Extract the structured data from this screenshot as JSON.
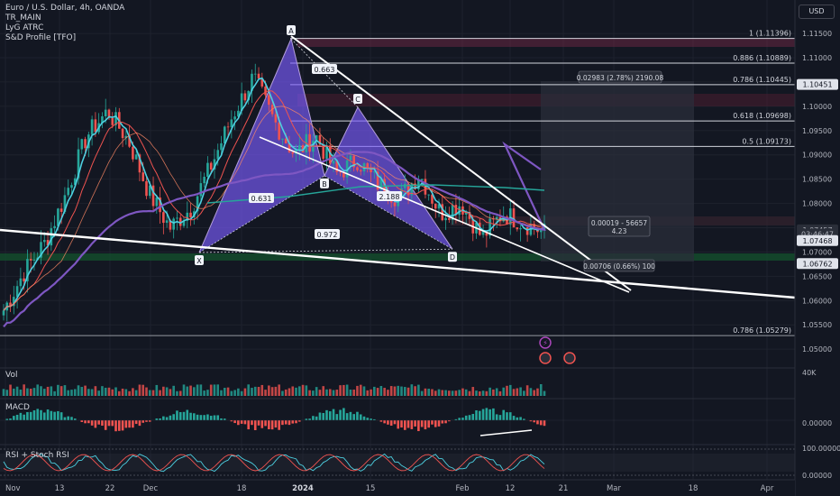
{
  "header": {
    "title": "Euro / U.S. Dollar, 4h, OANDA",
    "indicators": [
      "TR_MAIN",
      "LyG ATRC",
      "S&D Profile [TFO]"
    ]
  },
  "currency_button": "USD",
  "price_axis": {
    "ticks": [
      "1.11500",
      "1.11000",
      "1.10500",
      "1.10000",
      "1.09500",
      "1.09000",
      "1.08500",
      "1.08000",
      "1.07500",
      "1.07000",
      "1.06500",
      "1.06000",
      "1.05500",
      "1.05000"
    ],
    "badges": [
      {
        "text": "1.10451",
        "value": 1.10451,
        "style": "light"
      },
      {
        "text": "1.07457",
        "value": 1.07457,
        "style": "dark"
      },
      {
        "text": "03:46:47",
        "value": 1.0737,
        "style": "dark"
      },
      {
        "text": "1.07468",
        "value": 1.07235,
        "style": "light"
      },
      {
        "text": "1.06762",
        "value": 1.06762,
        "style": "light"
      }
    ]
  },
  "time_axis": {
    "ticks": [
      {
        "text": "Nov",
        "bold": false
      },
      {
        "text": "13",
        "bold": false
      },
      {
        "text": "22",
        "bold": false
      },
      {
        "text": "Dec",
        "bold": false
      },
      {
        "text": "18",
        "bold": false
      },
      {
        "text": "2024",
        "bold": true
      },
      {
        "text": "15",
        "bold": false
      },
      {
        "text": "Feb",
        "bold": false
      },
      {
        "text": "12",
        "bold": false
      },
      {
        "text": "21",
        "bold": false
      },
      {
        "text": "Mar",
        "bold": false
      },
      {
        "text": "18",
        "bold": false
      },
      {
        "text": "Apr",
        "bold": false
      }
    ]
  },
  "fib_levels": [
    {
      "label": "1 (1.11396)",
      "value": 1.11396
    },
    {
      "label": "0.886 (1.10889)",
      "value": 1.10889
    },
    {
      "label": "0.786 (1.10445)",
      "value": 1.10445
    },
    {
      "label": "0.618 (1.09698)",
      "value": 1.09698
    },
    {
      "label": "0.5 (1.09173)",
      "value": 1.09173
    },
    {
      "label": "0.786 (1.05279)",
      "value": 1.05279
    }
  ],
  "harmonic": {
    "points": [
      {
        "label": "X",
        "value": 1.0699
      },
      {
        "label": "A",
        "value": 1.1139
      },
      {
        "label": "B",
        "value": 1.0857
      },
      {
        "label": "C",
        "value": 1.0998
      },
      {
        "label": "D",
        "value": 1.0706
      }
    ],
    "ratios": [
      "0.663",
      "0.631",
      "0.972",
      "2.188"
    ]
  },
  "measure_boxes": [
    {
      "lines": [
        "0.02983 (2.78%) 2190.08"
      ]
    },
    {
      "lines": [
        "0.00019 - 56657",
        "4.23"
      ]
    },
    {
      "lines": [
        "0.00706 (0.66%) 100"
      ]
    }
  ],
  "panes": {
    "volume": {
      "label": "Vol",
      "ticks": [
        "40K"
      ]
    },
    "macd": {
      "label": "MACD",
      "ticks": [
        "0.00000"
      ]
    },
    "rsi": {
      "label": "RSI + Stoch RSI",
      "ticks": [
        "100.00000",
        "0.00000"
      ]
    }
  },
  "colors": {
    "background": "#131722",
    "bull": "#26a69a",
    "bear": "#ef5350",
    "pattern_fill": "#7b5cff",
    "ema_fast": "#4dd0e1",
    "ema_slow": "#ef5350",
    "ema_long": "#7e57c2",
    "line": "#ffffff"
  },
  "chart_data": {
    "type": "candlestick",
    "symbol": "Euro / U.S. Dollar",
    "interval": "4h",
    "ylim": [
      1.0465,
      1.1178
    ],
    "x_range_labels": [
      "Nov",
      "Apr"
    ],
    "close_approx": [
      1.058,
      1.066,
      1.072,
      1.082,
      1.094,
      1.099,
      1.093,
      1.082,
      1.075,
      1.079,
      1.088,
      1.098,
      1.106,
      1.097,
      1.09,
      1.094,
      1.086,
      1.089,
      1.084,
      1.081,
      1.086,
      1.078,
      1.08,
      1.073,
      1.078,
      1.076,
      1.074
    ]
  }
}
